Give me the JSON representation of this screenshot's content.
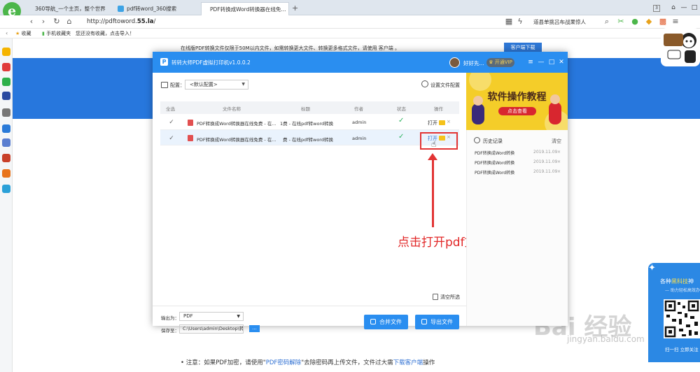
{
  "browser": {
    "tabs": [
      {
        "label": "360导航_一个主页，整个世界",
        "active": false
      },
      {
        "label": "pdf转word_360搜索",
        "active": false
      },
      {
        "label": "PDF转换成Word转换器在线免...",
        "active": true
      }
    ],
    "new_tab": "+",
    "url_prefix": "http://pdftoword.",
    "url_domain": "55.la",
    "url_suffix": "/",
    "search_text": "道县单挑吕布战果惊人",
    "bookmarks": {
      "star_label": "收藏",
      "mobile_label": "手机收藏夹",
      "hint": "您还没有收藏，点击导入！"
    }
  },
  "page": {
    "notice": "在线版PDF转换文件仅限于50M以内文件，如需转换更大文件、转换更多格式文件，请使用 客户端 。",
    "client_button": "客户端下载",
    "footer_prefix": "•  注意：如果PDF加密，请使用\"",
    "footer_link1": "PDF密码解除",
    "footer_mid": "\"去除密码再上传文件，文件过大需",
    "footer_link2": "下载客户端",
    "footer_suffix": "操作"
  },
  "app": {
    "title": "转转大师PDF虚拟打印机v1.0.0.2",
    "username": "好好先...",
    "vip_button": "开通VIP",
    "controls": [
      "≡",
      "—",
      "□",
      "✕"
    ],
    "config_label": "配置：",
    "config_value": "<默认配置>",
    "settings_label": "设置文件配置",
    "columns": [
      "全选",
      "文件名称",
      "标题",
      "作者",
      "状态",
      "操作"
    ],
    "rows": [
      {
        "filename": "PDF转换成Word转换器在线免费 - 在...",
        "title": "1费 - 在线pdf转word转换",
        "author": "admin",
        "status": "✓",
        "action": "打开",
        "remove": "×"
      },
      {
        "filename": "PDF转换成Word转换器在线免费 - 在...",
        "title": "费 - 在线pdf转word转换",
        "author": "admin",
        "status": "✓",
        "action": "打开",
        "remove": "×"
      }
    ],
    "clear_label": "清空所选",
    "output_label": "输出为：",
    "output_value": "PDF",
    "save_label": "保存至：",
    "save_path": "C:\\Users\\admin\\Desktop\\转...",
    "browse_label": "...",
    "merge_button": "合并文件",
    "export_button": "导出文件",
    "ad_title": "软件操作教程",
    "ad_button": "点击查看",
    "history_title": "历史记录",
    "history_clear": "清空",
    "history": [
      {
        "name": "PDF转换成Word转换",
        "date": "2019.11.09",
        "x": "×"
      },
      {
        "name": "PDF转换成Word转换",
        "date": "2019.11.09",
        "x": "×"
      },
      {
        "name": "PDF转换成Word转换",
        "date": "2019.11.09",
        "x": "×"
      }
    ]
  },
  "annotation": "点击打开pdf文件",
  "widget": {
    "line1_prefix": "各种",
    "line1_hl": "黑科技",
    "line1_suffix": "神",
    "line2": "— 助力轻松高效办",
    "caption": "扫一扫 立即关注"
  },
  "watermark": {
    "main": "Bai 经验",
    "sub": "jingyan.baidu.com"
  },
  "colors": {
    "app_blue": "#2a8ef0",
    "banner_blue": "#2777dd",
    "annotation_red": "#e22828",
    "ad_yellow": "#f4cd29"
  }
}
